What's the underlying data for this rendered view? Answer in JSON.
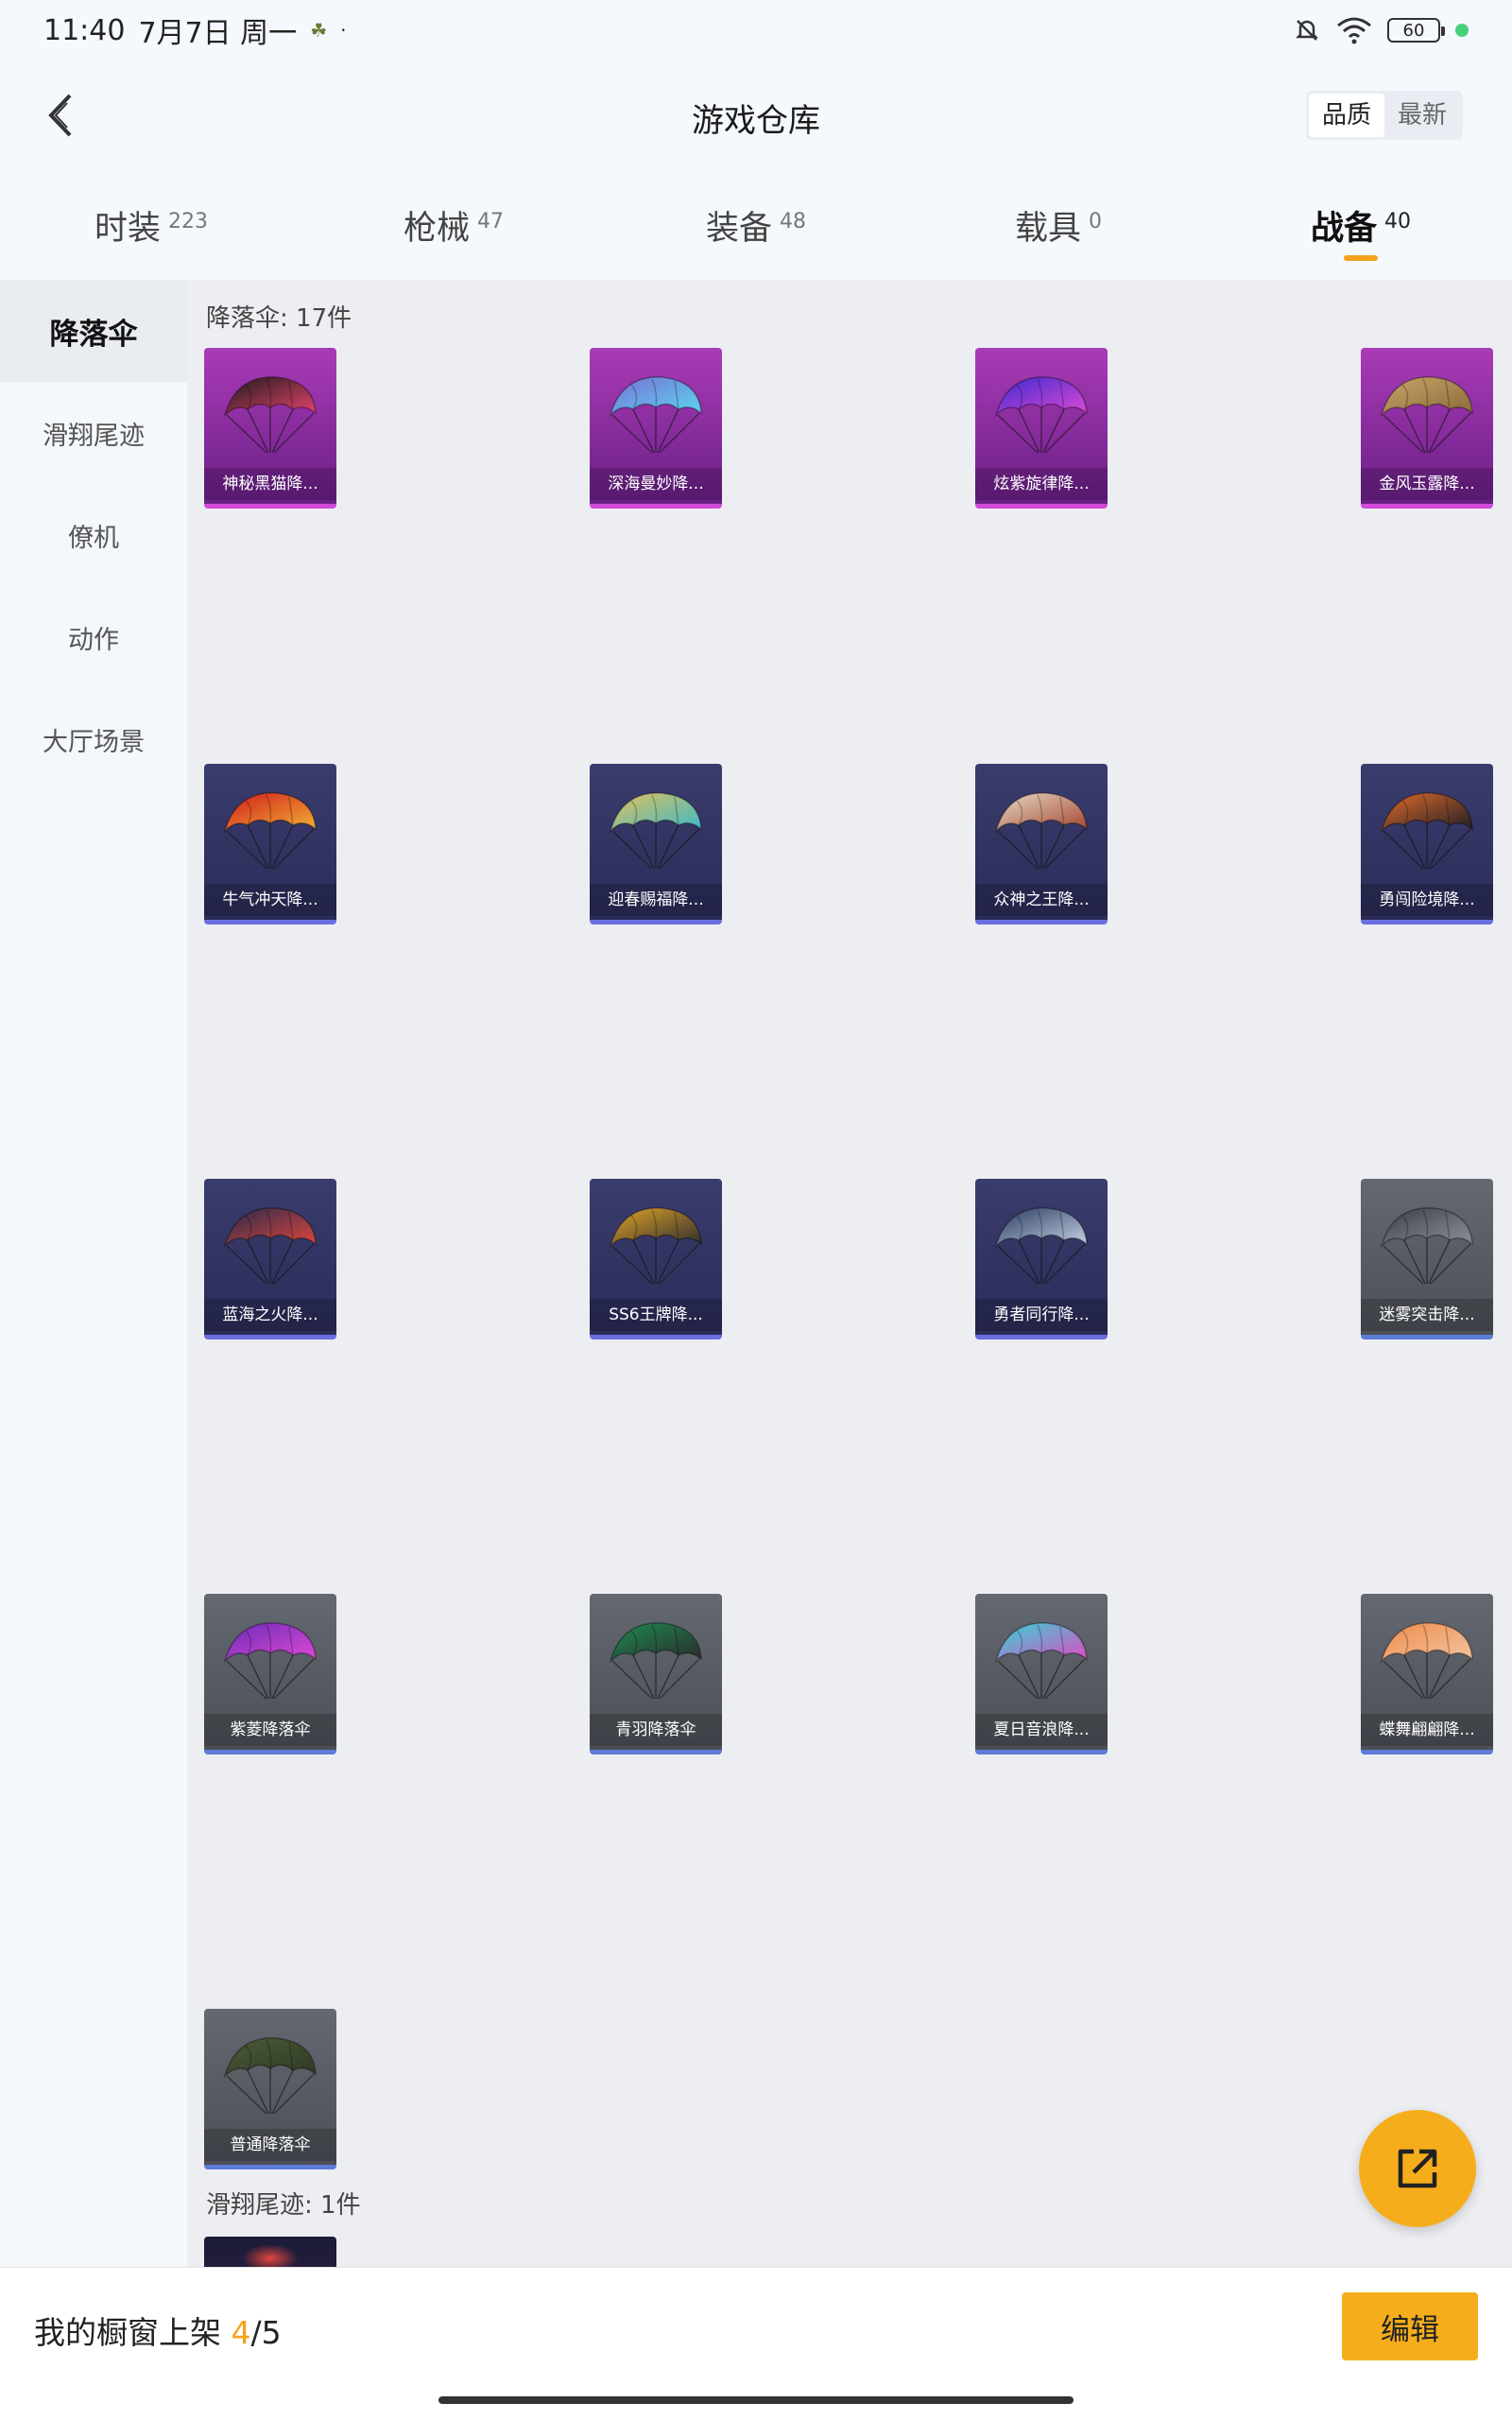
{
  "status_bar": {
    "time": "11:40",
    "date": "7月7日 周一",
    "battery": "60"
  },
  "header": {
    "title": "游戏仓库",
    "sort_options": [
      "品质",
      "最新"
    ]
  },
  "tabs": [
    {
      "label": "时装",
      "count": "223"
    },
    {
      "label": "枪械",
      "count": "47"
    },
    {
      "label": "装备",
      "count": "48"
    },
    {
      "label": "载具",
      "count": "0"
    },
    {
      "label": "战备",
      "count": "40"
    }
  ],
  "sidebar": {
    "items": [
      "降落伞",
      "滑翔尾迹",
      "僚机",
      "动作",
      "大厅场景"
    ]
  },
  "sections": [
    {
      "title": "降落伞: 17件"
    },
    {
      "title": "滑翔尾迹: 1件"
    }
  ],
  "items": [
    {
      "name": "神秘黑猫降...",
      "quality": "purple",
      "art_colors": [
        "#1b1b1b",
        "#e8436c"
      ]
    },
    {
      "name": "深海曼妙降...",
      "quality": "purple",
      "art_colors": [
        "#7a6fd6",
        "#5bd7f0"
      ]
    },
    {
      "name": "炫紫旋律降...",
      "quality": "purple",
      "art_colors": [
        "#3b2ad0",
        "#e04ad6"
      ]
    },
    {
      "name": "金风玉露降...",
      "quality": "purple",
      "art_colors": [
        "#c9a56a",
        "#8a6a3a"
      ]
    },
    {
      "name": "牛气冲天降...",
      "quality": "blue",
      "art_colors": [
        "#d11c1c",
        "#f2b233"
      ]
    },
    {
      "name": "迎春赐福降...",
      "quality": "blue",
      "art_colors": [
        "#e3c25b",
        "#3ab8c9"
      ]
    },
    {
      "name": "众神之王降...",
      "quality": "blue",
      "art_colors": [
        "#e9dcc6",
        "#a3452f"
      ]
    },
    {
      "name": "勇闯险境降...",
      "quality": "blue",
      "art_colors": [
        "#e26b2b",
        "#1d1d24"
      ]
    },
    {
      "name": "蓝海之火降...",
      "quality": "blue",
      "art_colors": [
        "#262a4a",
        "#e0463e"
      ]
    },
    {
      "name": "SS6王牌降...",
      "quality": "blue",
      "art_colors": [
        "#e3a52a",
        "#2b2b2b"
      ]
    },
    {
      "name": "勇者同行降...",
      "quality": "blue",
      "art_colors": [
        "#263a5e",
        "#c9d3e6"
      ]
    },
    {
      "name": "迷雾突击降...",
      "quality": "grey",
      "art_colors": [
        "#3a3d44",
        "#8f949c"
      ]
    },
    {
      "name": "紫菱降落伞",
      "quality": "grey",
      "art_colors": [
        "#6a2bb6",
        "#e04ad6"
      ]
    },
    {
      "name": "青羽降落伞",
      "quality": "grey",
      "art_colors": [
        "#1f8a52",
        "#2b2b2b"
      ]
    },
    {
      "name": "夏日音浪降...",
      "quality": "grey",
      "art_colors": [
        "#33d6d6",
        "#e04ac2"
      ]
    },
    {
      "name": "蝶舞翩翩降...",
      "quality": "grey",
      "art_colors": [
        "#f08a4a",
        "#f2c6a0"
      ]
    },
    {
      "name": "普通降落伞",
      "quality": "grey",
      "art_colors": [
        "#4c5a3a",
        "#2f3a24"
      ]
    }
  ],
  "bottom_bar": {
    "label": "我的橱窗上架 ",
    "count": "4",
    "total": "/5",
    "edit_label": "编辑"
  },
  "colors": {
    "accent": "#f6ad1b",
    "purple_quality": "#d24ad8",
    "blue_quality": "#6a6fe0"
  }
}
